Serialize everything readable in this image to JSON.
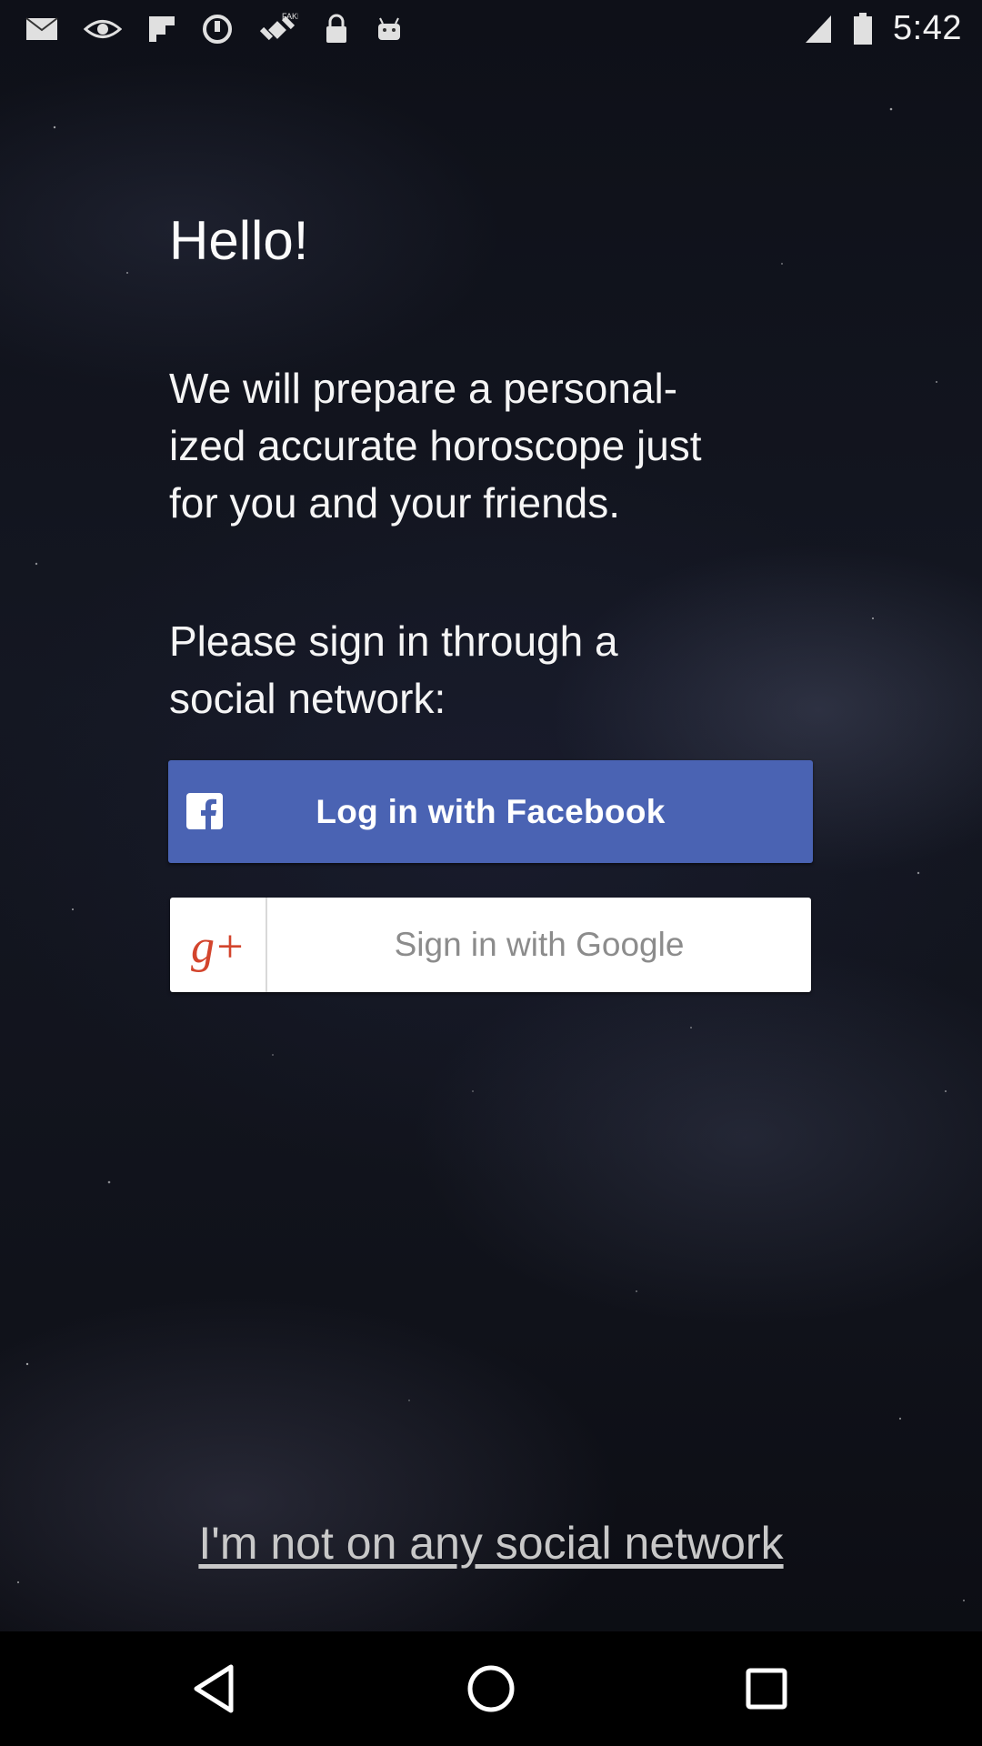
{
  "status_bar": {
    "time": "5:42",
    "icons": [
      "mail-icon",
      "eye-icon",
      "flipboard-icon",
      "sync-icon",
      "fake-gps-icon",
      "lock-icon",
      "android-icon",
      "signal-icon",
      "battery-icon"
    ]
  },
  "main": {
    "greeting": "Hello!",
    "intro_line1": "We will prepare a personal-",
    "intro_line2": "ized accurate horoscope just",
    "intro_line3": "for you and your friends.",
    "prompt_line1": "Please sign in through a",
    "prompt_line2": "social network:"
  },
  "facebook_button": {
    "label": "Log in with Facebook",
    "icon": "facebook-icon",
    "color": "#4a63b3"
  },
  "google_button": {
    "label": "Sign in with Google",
    "icon_text": "g+",
    "icon": "google-plus-icon",
    "icon_color": "#d3442c"
  },
  "no_social_link": {
    "label": "I'm not on any social network"
  },
  "nav_bar": {
    "buttons": [
      "back-icon",
      "home-icon",
      "recents-icon"
    ]
  }
}
